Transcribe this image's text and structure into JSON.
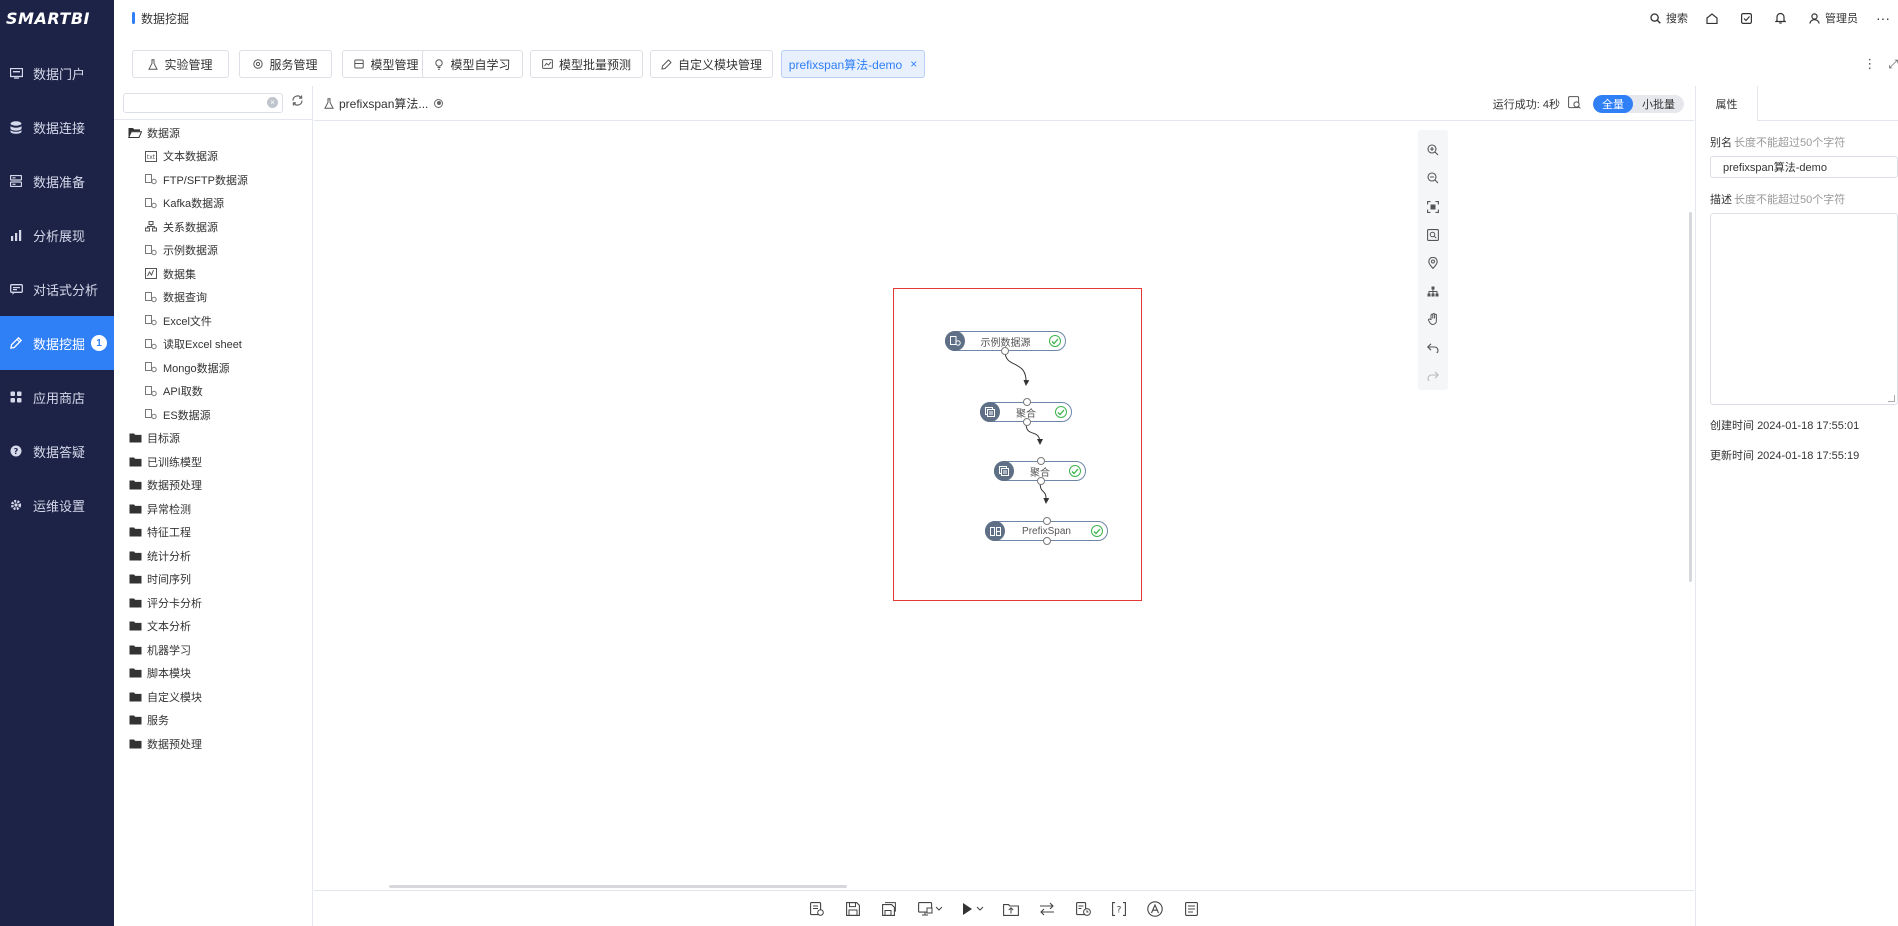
{
  "app": {
    "logo": "SMARTBI",
    "page_title": "数据挖掘"
  },
  "top_right": {
    "search": "搜索",
    "user": "管理员"
  },
  "sidebar": {
    "items": [
      {
        "label": "数据门户",
        "icon": "portal-icon"
      },
      {
        "label": "数据连接",
        "icon": "database-icon"
      },
      {
        "label": "数据准备",
        "icon": "prepare-icon"
      },
      {
        "label": "分析展现",
        "icon": "chart-icon"
      },
      {
        "label": "对话式分析",
        "icon": "chat-icon"
      },
      {
        "label": "数据挖掘",
        "icon": "mining-icon",
        "active": true,
        "badge": "1"
      },
      {
        "label": "应用商店",
        "icon": "store-icon"
      },
      {
        "label": "数据答疑",
        "icon": "question-icon"
      },
      {
        "label": "运维设置",
        "icon": "settings-icon"
      }
    ]
  },
  "tabs": [
    {
      "label": "实验管理"
    },
    {
      "label": "服务管理"
    },
    {
      "label": "模型管理"
    },
    {
      "label": "模型自学习"
    },
    {
      "label": "模型批量预测"
    },
    {
      "label": "自定义模块管理"
    },
    {
      "label": "prefixspan算法-demo",
      "active": true
    }
  ],
  "tree": {
    "search_placeholder": "",
    "root": "数据源",
    "children": [
      "文本数据源",
      "FTP/SFTP数据源",
      "Kafka数据源",
      "关系数据源",
      "示例数据源",
      "数据集",
      "数据查询",
      "Excel文件",
      "读取Excel sheet",
      "Mongo数据源",
      "API取数",
      "ES数据源"
    ],
    "folders": [
      "目标源",
      "已训练模型",
      "数据预处理",
      "异常检测",
      "特征工程",
      "统计分析",
      "时间序列",
      "评分卡分析",
      "文本分析",
      "机器学习",
      "脚本模块",
      "自定义模块",
      "服务",
      "数据预处理"
    ]
  },
  "canvas_head": {
    "experiment_name": "prefixspan算法...",
    "run_status": "运行成功: 4秒",
    "mode_full": "全量",
    "mode_batch": "小批量"
  },
  "flow": {
    "nodes": [
      {
        "label": "示例数据源",
        "status": "success",
        "icon": "datasource-icon"
      },
      {
        "label": "聚合",
        "status": "success",
        "icon": "aggregate-icon"
      },
      {
        "label": "聚合",
        "status": "success",
        "icon": "aggregate-icon"
      },
      {
        "label": "PrefixSpan",
        "status": "success",
        "icon": "algorithm-icon"
      }
    ]
  },
  "properties": {
    "tab": "属性",
    "alias_label": "别名",
    "alias_hint": "长度不能超过50个字符",
    "alias_value": "prefixspan算法-demo",
    "desc_label": "描述",
    "desc_hint": "长度不能超过50个字符",
    "desc_value": "",
    "created_label": "创建时间",
    "created_value": "2024-01-18 17:55:01",
    "updated_label": "更新时间",
    "updated_value": "2024-01-18 17:55:19"
  },
  "colors": {
    "sidebar_bg": "#1d2247",
    "accent": "#2f7ff7",
    "success": "#3bb34a",
    "selection": "#e53935"
  }
}
